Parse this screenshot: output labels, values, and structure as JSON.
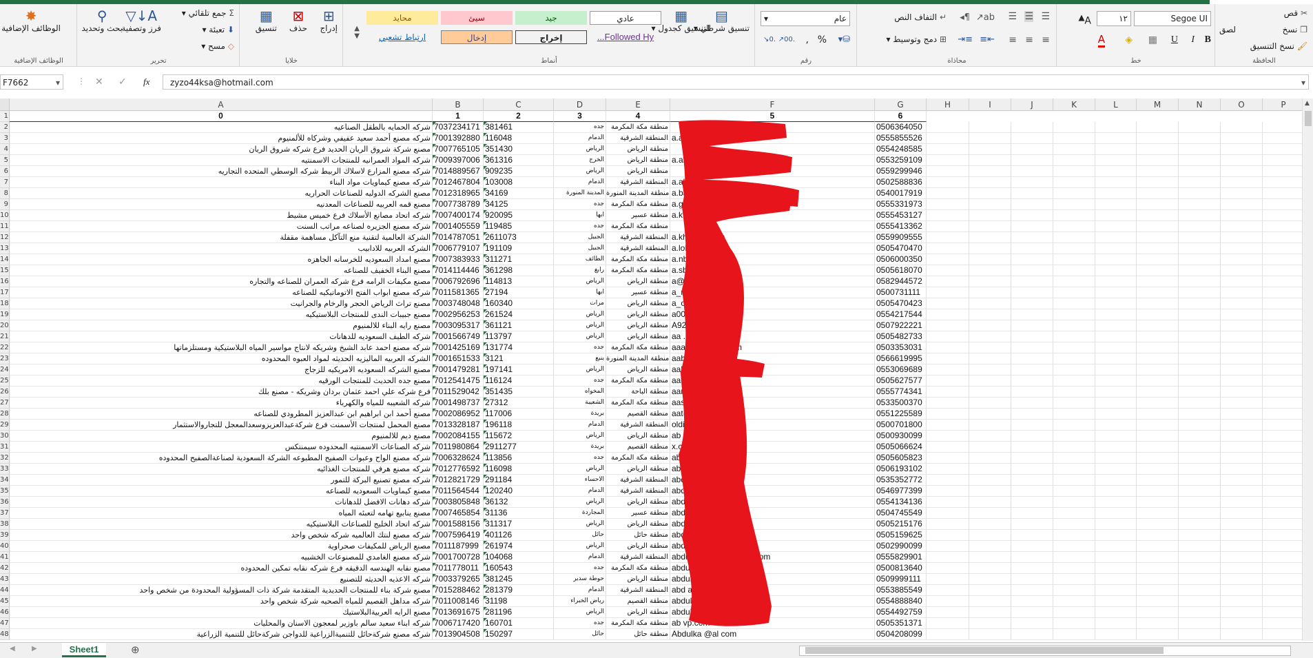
{
  "ribbon": {
    "clipboard": {
      "label": "الحافظة",
      "cut": "قص",
      "copy": "نسخ",
      "format_painter": "نسخ التنسيق",
      "paste": "لصق"
    },
    "font": {
      "label": "خط",
      "name": "Segoe UI",
      "size": "١٢",
      "bold": "B",
      "italic": "I",
      "underline": "U"
    },
    "alignment": {
      "label": "محاذاة",
      "wrap": "التفاف النص",
      "merge": "دمج وتوسيط"
    },
    "number": {
      "label": "رقم",
      "format": "عام",
      "percent": "%",
      "comma": ","
    },
    "styles": {
      "label": "أنماط",
      "conditional": "تنسيق شرطي",
      "table": "التنسيق كجدول",
      "normal": "عادي",
      "good": "جيد",
      "bad": "سيئ",
      "neutral": "محايد",
      "output": "إخراج",
      "input": "إدخال",
      "followed": "Followed Hy...",
      "hyperlink": "ارتباط تشعبي"
    },
    "cells": {
      "label": "خلايا",
      "insert": "إدراج",
      "delete": "حذف",
      "format": "تنسيق"
    },
    "editing": {
      "label": "تحرير",
      "autosum": "جمع تلقائي",
      "fill": "تعبئة",
      "clear": "مسح",
      "sort": "فرز وتصفية",
      "find": "بحث وتحديد"
    },
    "addins": {
      "label": "الوظائف الإضافية",
      "button": "الوظائف الإضافية"
    }
  },
  "formula_bar": {
    "name_box": "F7662",
    "fx": "fx",
    "value": "zyzo44ksa@hotmail.com"
  },
  "columns": [
    "A",
    "B",
    "C",
    "D",
    "E",
    "F",
    "G",
    "H",
    "I",
    "J",
    "K",
    "L",
    "M",
    "N",
    "O",
    "P"
  ],
  "header_row": [
    "0",
    "1",
    "2",
    "3",
    "4",
    "5",
    "6"
  ],
  "rows": [
    {
      "n": "2",
      "a": "شركه الحمايه بالطقل الصناعيه",
      "b": "7037234171",
      "c": "381461",
      "d": "جده",
      "e": "منطقة مكة المكرمة",
      "f": "",
      "g": "0506364050"
    },
    {
      "n": "3",
      "a": "شركه مصنع أحمد سعيد عفيفي وشركاه للألمنيوم",
      "b": "7001392880",
      "c": "116048",
      "d": "الدمام",
      "e": "المنطقة الشرقية",
      "f": "a.afi",
      "g": "0555855526"
    },
    {
      "n": "4",
      "a": "مصنع شركة شروق الريان الحديد فرع شركه شروق الريان",
      "b": "7007765105",
      "c": "351430",
      "d": "الرياض",
      "e": "منطقة الرياض",
      "f": "",
      "g": "0554248585"
    },
    {
      "n": "5",
      "a": "شركه المواد العمرانيه للمنتجات الاسمنتيه",
      "b": "7009397006",
      "c": "361316",
      "d": "الخرج",
      "e": "منطقة الرياض",
      "f": "a.almu                    m.sa",
      "g": "0553259109"
    },
    {
      "n": "6",
      "a": "شركه مصنع المزارع لاسلاك الربيط شركه الوسطي المتحده التجاريه",
      "b": "7014889567",
      "c": "909235",
      "d": "الرياض",
      "e": "منطقة الرياض",
      "f": "",
      "g": "0559299946"
    },
    {
      "n": "7",
      "a": "شركه مصنع كيماويات مواد البناء",
      "b": "7012467804",
      "c": "103008",
      "d": "الدمام",
      "e": "المنطقة الشرقية",
      "f": "a.alla                 sa.com",
      "g": "0502588836"
    },
    {
      "n": "8",
      "a": "مصنع الشركه الدوليه للصناعات الحراريه",
      "b": "7012318965",
      "c": "34169",
      "d": "المدينة المنورة",
      "e": "منطقة المدينة المنورة",
      "f": "a.ba",
      "g": "0540017919"
    },
    {
      "n": "9",
      "a": "مصنع قمه العربيه للصناعات المعدنيه",
      "b": "7007738789",
      "c": "34125",
      "d": "جده",
      "e": "منطقة مكة المكرمة",
      "f": "a.g",
      "g": "0555331973"
    },
    {
      "n": "10",
      "a": "شركه اتحاد مصانع الأسلاك فرع خميس مشيط",
      "b": "7007400174",
      "c": "920095",
      "d": "ابها",
      "e": "منطقة عسير",
      "f": "a.k",
      "g": "0555453127"
    },
    {
      "n": "11",
      "a": "شركه مصنع الجزيره لصناعه مراتب السنت",
      "b": "7001405559",
      "c": "119485",
      "d": "جده",
      "e": "منطقة مكة المكرمة",
      "f": "",
      "g": "0555413362"
    },
    {
      "n": "12",
      "a": "الشركة العالمية لتقنية منع التآكل مساهمة مقفلة",
      "b": "7014787051",
      "c": "2611073",
      "d": "الجبيل",
      "e": "المنطقة الشرقية",
      "f": "a.khonai                          l.com",
      "g": "0559909555"
    },
    {
      "n": "13",
      "a": "الشركه العربيه للادابيب",
      "b": "7006779107",
      "c": "191109",
      "d": "الجبيل",
      "e": "المنطقة الشرقية",
      "f": "a.loha",
      "g": "0505470470"
    },
    {
      "n": "14",
      "a": "مصنع امداد السعوديه للخرسانه الجاهزه",
      "b": "7007383933",
      "c": "311271",
      "d": "الطائف",
      "e": "منطقة مكة المكرمة",
      "f": "a.nb1",
      "g": "0506000350"
    },
    {
      "n": "15",
      "a": "مصنع البناء الخفيف للصناعه",
      "b": "7014114446",
      "c": "361298",
      "d": "رابغ",
      "e": "منطقة مكة المكرمة",
      "f": "a.sb",
      "g": "0505618070"
    },
    {
      "n": "16",
      "a": "مصنع مكيفات الرامه فرع شركه العمران للصناعه والتجاره",
      "b": "7006792696",
      "c": "114813",
      "d": "الرياض",
      "e": "منطقة الرياض",
      "f": "a@al",
      "g": "0582944572"
    },
    {
      "n": "17",
      "a": "شركه مصنع ابواب الفتح الاتوماتيكيه للصناعه",
      "b": "7011581365",
      "c": "27194",
      "d": "ابها",
      "e": "منطقة عسير",
      "f": "a_n",
      "g": "0500731111"
    },
    {
      "n": "18",
      "a": "مصنع تراث الرياض الحجر والرخام والجرانيت",
      "b": "7003748048",
      "c": "160340",
      "d": "مرات",
      "e": "منطقة الرياض",
      "f": "a_othm                 .com",
      "g": "0505470423"
    },
    {
      "n": "19",
      "a": "مصنع جبيبات الندى للمنتجات البلاستيكيه",
      "b": "7002956253",
      "c": "261524",
      "d": "الرياض",
      "e": "منطقة الرياض",
      "f": "a0009",
      "g": "0554217544"
    },
    {
      "n": "20",
      "a": "مصنع رايه البناء للالمنيوم",
      "b": "7003095317",
      "c": "361121",
      "d": "الرياض",
      "e": "منطقة الرياض",
      "f": "A9200",
      "g": "0507922221"
    },
    {
      "n": "21",
      "a": "شركه الطيف السعوديه للدهانات",
      "b": "7001566749",
      "c": "113797",
      "d": "الرياض",
      "e": "منطقة الرياض",
      "f": "aa             .com",
      "g": "0505482733"
    },
    {
      "n": "22",
      "a": "شركه مصنع احمد عابد الشيخ وشريكه لانتاج مواسير المياه البلاستيكية ومستلزماتها",
      "b": "7001425169",
      "c": "131774",
      "d": "جده",
      "e": "منطقة مكة المكرمة",
      "f": "aaalsheik           mail.com",
      "g": "0503353031"
    },
    {
      "n": "23",
      "a": "الشركه العربيه الماليزيه الحديثه لمواد العبوه المحدوده",
      "b": "7001651533",
      "c": "3121",
      "d": "ينبع",
      "e": "منطقة المدينة المنورة",
      "f": "aabala",
      "g": "0566619995"
    },
    {
      "n": "24",
      "a": "مصنع الشركه السعوديه الامريكيه للزجاج",
      "b": "7001479281",
      "c": "197141",
      "d": "الرياض",
      "e": "منطقة الرياض",
      "f": "aaliess         .com",
      "g": "0553069689"
    },
    {
      "n": "25",
      "a": "مصنع جده الحديث للمنتجات الورقيه",
      "b": "7012541475",
      "c": "116124",
      "d": "جده",
      "e": "منطقة مكة المكرمة",
      "f": "aalkho",
      "g": "0505627577"
    },
    {
      "n": "26",
      "a": "فرع شركه علي احمد عثمان بردان وشريكه - مصنع بلك",
      "b": "7011529042",
      "c": "351435",
      "d": "المخواه",
      "e": "منطقة الباحة",
      "f": "aam55              .com",
      "g": "0555774341"
    },
    {
      "n": "27",
      "a": "شركه الشعيبه للمياه والكهرباء",
      "b": "7001498737",
      "c": "27312",
      "d": "الشعيبة",
      "e": "منطقة مكة المكرمة",
      "f": "aassiry@         wpp.com",
      "g": "0533500370"
    },
    {
      "n": "28",
      "a": "مصنع أحمد ابن ابراهيم ابن عبدالعزيز المطرودي للصناعه",
      "b": "7002086952",
      "c": "117006",
      "d": "بريدة",
      "e": "منطقة القصيم",
      "f": "aat@",
      "g": "0551225589"
    },
    {
      "n": "29",
      "a": "مصنع المحمل لمنتجات الأسمنت فرع شركةعبدالعزيزوسعدالمعجل للتجاروالاستثمار",
      "b": "7013328187",
      "c": "196118",
      "d": "الدمام",
      "e": "المنطقة الشرقية",
      "f": "               olding.com",
      "g": "0500701800"
    },
    {
      "n": "30",
      "a": "مصنع ديم للالمنيوم",
      "b": "7002084155",
      "c": "115672",
      "d": "الرياض",
      "e": "منطقة الرياض",
      "f": "ab              .com",
      "g": "0500930099"
    },
    {
      "n": "31",
      "a": "شركه الصناعات الاسمنتيه المحدوده سيمنتكس",
      "b": "7011980864",
      "c": "2911277",
      "d": "بريدة",
      "e": "منطقة القصيم",
      "f": "                 x.com.sa",
      "g": "0505066624"
    },
    {
      "n": "32",
      "a": "شركه مصنع الواح وعبوات الصفيح المطبوعه الشركة السعودية لصناعةالصفيح المحدوده",
      "b": "7006328624",
      "c": "113856",
      "d": "جده",
      "e": "منطقة مكة المكرمة",
      "f": "abashe",
      "g": "0505605823"
    },
    {
      "n": "33",
      "a": "شركه مصنع هرفي للمنتجات الغذائيه",
      "b": "7012776592",
      "c": "116098",
      "d": "الرياض",
      "e": "منطقة الرياض",
      "f": "abbass",
      "g": "0506193102"
    },
    {
      "n": "34",
      "a": "شركه مصنع تصنيع البركة للتمور",
      "b": "7012821729",
      "c": "291184",
      "d": "الاحساء",
      "e": "المنطقة الشرقية",
      "f": "abd                ail.com",
      "g": "0535352772"
    },
    {
      "n": "35",
      "a": "مصنع كيماويات السعوديه للصناعه",
      "b": "7011564544",
      "c": "120240",
      "d": "الدمام",
      "e": "المنطقة الشرقية",
      "f": "abd",
      "g": "0546977399"
    },
    {
      "n": "36",
      "a": "شركه دهانات الافضل للدهانات",
      "b": "7003805848",
      "c": "36132",
      "d": "الرياض",
      "e": "منطقة الرياض",
      "f": "abdalla         .com",
      "g": "0554134136"
    },
    {
      "n": "37",
      "a": "مصنع ينابيع تهامه لتعبئه المياه",
      "b": "7007465854",
      "c": "31136",
      "d": "المجاردة",
      "e": "منطقة عسير",
      "f": "abdalla           @gmail.com",
      "g": "0504745549"
    },
    {
      "n": "38",
      "a": "شركه اتحاد الخليج للصناعات البلاستيكيه",
      "b": "7001588156",
      "c": "311317",
      "d": "الرياض",
      "e": "منطقة الرياض",
      "f": "abdalla          on.com",
      "g": "0505215176"
    },
    {
      "n": "39",
      "a": "شركه مصنع لنتك العالميه شركه شخص واحد",
      "b": "7007596419",
      "c": "401126",
      "d": "حائل",
      "e": "منطقة حائل",
      "f": "abd               gmail.com",
      "g": "0505159625"
    },
    {
      "n": "40",
      "a": "مصنع الرياض للمكيفات صحراوية",
      "b": "7011187999",
      "c": "261974",
      "d": "الرياض",
      "e": "منطقة الرياض",
      "f": "abd",
      "g": "0502990099"
    },
    {
      "n": "41",
      "a": "شركه مصنع الغامدي للمصنوعات الخشبيه",
      "b": "7001700728",
      "c": "104068",
      "d": "الدمام",
      "e": "المنطقة الشرقية",
      "f": "abdualrah          amdiwoods.com",
      "g": "0555829901"
    },
    {
      "n": "42",
      "a": "مصنع نقابه الهندسه الدقيقه فرع شركه نقابه تمكين المحدوده",
      "b": "7011778011",
      "c": "160543",
      "d": "جده",
      "e": "منطقة مكة المكرمة",
      "f": "abdul.          an.com",
      "g": "0500813640"
    },
    {
      "n": "43",
      "a": "شركه الاعذيه الحديثه للتصنيع",
      "b": "7003379265",
      "c": "381245",
      "d": "حوطة سدير",
      "e": "منطقة الرياض",
      "f": "abdula",
      "g": "0509999111"
    },
    {
      "n": "44",
      "a": "مصنع شركة بناء للمنتجات الحديدية المتقدمة شركة ذات المسؤولية المحدودة من شخص واحد",
      "b": "7015288462",
      "c": "281379",
      "d": "الدمام",
      "e": "المنطقة الشرقية",
      "f": "abd           a-steel.com",
      "g": "0553885549"
    },
    {
      "n": "45",
      "a": "شركه مداهل القصيم للمياه الصحيه شركة شخص واحد",
      "b": "7011008146",
      "c": "31198",
      "d": "رياض الخبراء",
      "e": "منطقة القصيم",
      "f": "abdula           elwater.com",
      "g": "0554888840"
    },
    {
      "n": "46",
      "a": "مصنع الرايه العربيةالبلاستيك",
      "b": "7013691675",
      "c": "281196",
      "d": "الرياض",
      "e": "منطقة الرياض",
      "f": "abdula          hotmail.com",
      "g": "0554492759"
    },
    {
      "n": "47",
      "a": "شركه ابناء سعيد سالم باوزير لمعجون الاسنان والمحليات",
      "b": "7006717420",
      "c": "160701",
      "d": "جده",
      "e": "منطقة مكة المكرمة",
      "f": "ab                 vp.com",
      "g": "0505351371"
    },
    {
      "n": "48",
      "a": "شركه مصنع شركةحائل للتنميةالزراعية للدواجن شركةحائل للتنمية الزراعية",
      "b": "7013904508",
      "c": "150297",
      "d": "حائل",
      "e": "منطقة حائل",
      "f": "Abdulka        @al          com",
      "g": "0504208099"
    }
  ],
  "sheet_tab": "Sheet1",
  "colors": {
    "excel_green": "#217346",
    "redaction": "#e8141b",
    "good_bg": "#c6efce",
    "bad_bg": "#ffc7ce",
    "neutral_bg": "#ffeb9c",
    "input_bg": "#ffcc99"
  }
}
